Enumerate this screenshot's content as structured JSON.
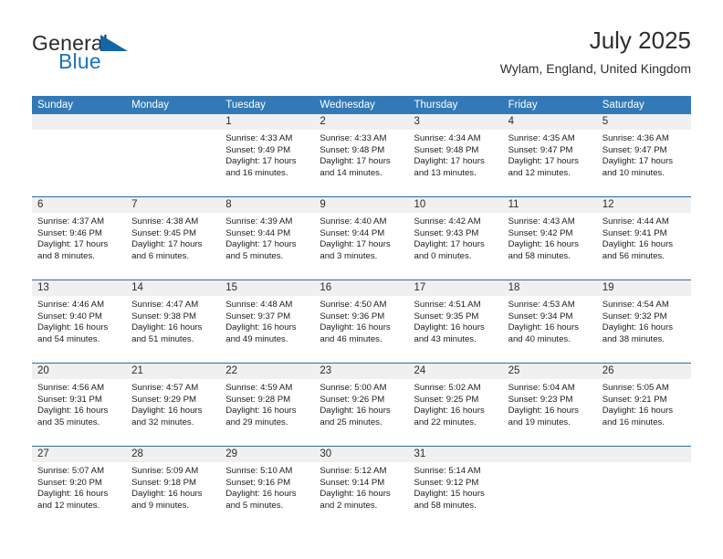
{
  "brand": {
    "word_one": "General",
    "word_two": "Blue",
    "triangle_icon": "triangle-logo-icon"
  },
  "header": {
    "title": "July 2025",
    "subtitle": "Wylam, England, United Kingdom"
  },
  "colors": {
    "header_blue": "#3279b7",
    "row_divider_blue": "#2c6ca6",
    "day_band_gray": "#f0f0f0",
    "brand_blue": "#1b74bb"
  },
  "weekday_headers": [
    "Sunday",
    "Monday",
    "Tuesday",
    "Wednesday",
    "Thursday",
    "Friday",
    "Saturday"
  ],
  "weeks": [
    [
      {
        "day": "",
        "sunrise": "",
        "sunset": "",
        "daylight": ""
      },
      {
        "day": "",
        "sunrise": "",
        "sunset": "",
        "daylight": ""
      },
      {
        "day": "1",
        "sunrise": "Sunrise: 4:33 AM",
        "sunset": "Sunset: 9:49 PM",
        "daylight": "Daylight: 17 hours and 16 minutes."
      },
      {
        "day": "2",
        "sunrise": "Sunrise: 4:33 AM",
        "sunset": "Sunset: 9:48 PM",
        "daylight": "Daylight: 17 hours and 14 minutes."
      },
      {
        "day": "3",
        "sunrise": "Sunrise: 4:34 AM",
        "sunset": "Sunset: 9:48 PM",
        "daylight": "Daylight: 17 hours and 13 minutes."
      },
      {
        "day": "4",
        "sunrise": "Sunrise: 4:35 AM",
        "sunset": "Sunset: 9:47 PM",
        "daylight": "Daylight: 17 hours and 12 minutes."
      },
      {
        "day": "5",
        "sunrise": "Sunrise: 4:36 AM",
        "sunset": "Sunset: 9:47 PM",
        "daylight": "Daylight: 17 hours and 10 minutes."
      }
    ],
    [
      {
        "day": "6",
        "sunrise": "Sunrise: 4:37 AM",
        "sunset": "Sunset: 9:46 PM",
        "daylight": "Daylight: 17 hours and 8 minutes."
      },
      {
        "day": "7",
        "sunrise": "Sunrise: 4:38 AM",
        "sunset": "Sunset: 9:45 PM",
        "daylight": "Daylight: 17 hours and 6 minutes."
      },
      {
        "day": "8",
        "sunrise": "Sunrise: 4:39 AM",
        "sunset": "Sunset: 9:44 PM",
        "daylight": "Daylight: 17 hours and 5 minutes."
      },
      {
        "day": "9",
        "sunrise": "Sunrise: 4:40 AM",
        "sunset": "Sunset: 9:44 PM",
        "daylight": "Daylight: 17 hours and 3 minutes."
      },
      {
        "day": "10",
        "sunrise": "Sunrise: 4:42 AM",
        "sunset": "Sunset: 9:43 PM",
        "daylight": "Daylight: 17 hours and 0 minutes."
      },
      {
        "day": "11",
        "sunrise": "Sunrise: 4:43 AM",
        "sunset": "Sunset: 9:42 PM",
        "daylight": "Daylight: 16 hours and 58 minutes."
      },
      {
        "day": "12",
        "sunrise": "Sunrise: 4:44 AM",
        "sunset": "Sunset: 9:41 PM",
        "daylight": "Daylight: 16 hours and 56 minutes."
      }
    ],
    [
      {
        "day": "13",
        "sunrise": "Sunrise: 4:46 AM",
        "sunset": "Sunset: 9:40 PM",
        "daylight": "Daylight: 16 hours and 54 minutes."
      },
      {
        "day": "14",
        "sunrise": "Sunrise: 4:47 AM",
        "sunset": "Sunset: 9:38 PM",
        "daylight": "Daylight: 16 hours and 51 minutes."
      },
      {
        "day": "15",
        "sunrise": "Sunrise: 4:48 AM",
        "sunset": "Sunset: 9:37 PM",
        "daylight": "Daylight: 16 hours and 49 minutes."
      },
      {
        "day": "16",
        "sunrise": "Sunrise: 4:50 AM",
        "sunset": "Sunset: 9:36 PM",
        "daylight": "Daylight: 16 hours and 46 minutes."
      },
      {
        "day": "17",
        "sunrise": "Sunrise: 4:51 AM",
        "sunset": "Sunset: 9:35 PM",
        "daylight": "Daylight: 16 hours and 43 minutes."
      },
      {
        "day": "18",
        "sunrise": "Sunrise: 4:53 AM",
        "sunset": "Sunset: 9:34 PM",
        "daylight": "Daylight: 16 hours and 40 minutes."
      },
      {
        "day": "19",
        "sunrise": "Sunrise: 4:54 AM",
        "sunset": "Sunset: 9:32 PM",
        "daylight": "Daylight: 16 hours and 38 minutes."
      }
    ],
    [
      {
        "day": "20",
        "sunrise": "Sunrise: 4:56 AM",
        "sunset": "Sunset: 9:31 PM",
        "daylight": "Daylight: 16 hours and 35 minutes."
      },
      {
        "day": "21",
        "sunrise": "Sunrise: 4:57 AM",
        "sunset": "Sunset: 9:29 PM",
        "daylight": "Daylight: 16 hours and 32 minutes."
      },
      {
        "day": "22",
        "sunrise": "Sunrise: 4:59 AM",
        "sunset": "Sunset: 9:28 PM",
        "daylight": "Daylight: 16 hours and 29 minutes."
      },
      {
        "day": "23",
        "sunrise": "Sunrise: 5:00 AM",
        "sunset": "Sunset: 9:26 PM",
        "daylight": "Daylight: 16 hours and 25 minutes."
      },
      {
        "day": "24",
        "sunrise": "Sunrise: 5:02 AM",
        "sunset": "Sunset: 9:25 PM",
        "daylight": "Daylight: 16 hours and 22 minutes."
      },
      {
        "day": "25",
        "sunrise": "Sunrise: 5:04 AM",
        "sunset": "Sunset: 9:23 PM",
        "daylight": "Daylight: 16 hours and 19 minutes."
      },
      {
        "day": "26",
        "sunrise": "Sunrise: 5:05 AM",
        "sunset": "Sunset: 9:21 PM",
        "daylight": "Daylight: 16 hours and 16 minutes."
      }
    ],
    [
      {
        "day": "27",
        "sunrise": "Sunrise: 5:07 AM",
        "sunset": "Sunset: 9:20 PM",
        "daylight": "Daylight: 16 hours and 12 minutes."
      },
      {
        "day": "28",
        "sunrise": "Sunrise: 5:09 AM",
        "sunset": "Sunset: 9:18 PM",
        "daylight": "Daylight: 16 hours and 9 minutes."
      },
      {
        "day": "29",
        "sunrise": "Sunrise: 5:10 AM",
        "sunset": "Sunset: 9:16 PM",
        "daylight": "Daylight: 16 hours and 5 minutes."
      },
      {
        "day": "30",
        "sunrise": "Sunrise: 5:12 AM",
        "sunset": "Sunset: 9:14 PM",
        "daylight": "Daylight: 16 hours and 2 minutes."
      },
      {
        "day": "31",
        "sunrise": "Sunrise: 5:14 AM",
        "sunset": "Sunset: 9:12 PM",
        "daylight": "Daylight: 15 hours and 58 minutes."
      },
      {
        "day": "",
        "sunrise": "",
        "sunset": "",
        "daylight": ""
      },
      {
        "day": "",
        "sunrise": "",
        "sunset": "",
        "daylight": ""
      }
    ]
  ]
}
